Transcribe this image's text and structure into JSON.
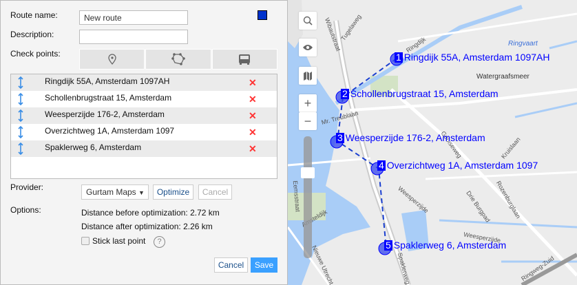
{
  "form": {
    "route_name_label": "Route name:",
    "route_name_value": "New route",
    "description_label": "Description:",
    "description_value": "",
    "checkpoints_label": "Check points:",
    "route_color": "#0033cc",
    "checkpoint_tabs": [
      "marker-icon",
      "polygon-icon",
      "bus-icon"
    ],
    "checkpoints": [
      {
        "label": "Ringdijk 55A, Amsterdam 1097AH"
      },
      {
        "label": "Schollenbrugstraat 15, Amsterdam"
      },
      {
        "label": "Weesperzijde 176-2, Amsterdam"
      },
      {
        "label": "Overzichtweg 1A, Amsterdam 1097"
      },
      {
        "label": "Spaklerweg 6, Amsterdam"
      }
    ],
    "delete_glyph": "✕",
    "provider_label": "Provider:",
    "provider_value": "Gurtam Maps",
    "optimize_label": "Optimize",
    "opt_cancel_label": "Cancel",
    "options_label": "Options:",
    "distance_before": "Distance before optimization: 2.72 km",
    "distance_after": "Distance after optimization: 2.26 km",
    "stick_last_point": "Stick last point",
    "stick_checked": false,
    "help": "?",
    "cancel_label": "Cancel",
    "save_label": "Save"
  },
  "map": {
    "markers": [
      {
        "num": "1",
        "label": "Ringdijk 55A, Amsterdam 1097AH"
      },
      {
        "num": "2",
        "label": "Schollenbrugstraat 15, Amsterdam"
      },
      {
        "num": "3",
        "label": "Weesperzijde 176-2, Amsterdam"
      },
      {
        "num": "4",
        "label": "Overzichtweg 1A, Amsterdam 1097"
      },
      {
        "num": "5",
        "label": "Spaklerweg 6, Amsterdam"
      }
    ],
    "streets": [
      "Wibautstraat",
      "Tugelaweg",
      "Ringdijk",
      "Ringvaart",
      "Watergraafsmeer",
      "Mr. Treublaan",
      "Gooiseweg",
      "Kruislaan",
      "Weesperzijde",
      "Drie Burgpad",
      "Rozenburglaan",
      "Eemsstraat",
      "Amsteldijk",
      "Nieuwe Utrecht",
      "Spaklerweg",
      "Weesperzijde",
      "Ringweg-Zuid"
    ],
    "zoom_in": "+",
    "zoom_out": "−"
  }
}
